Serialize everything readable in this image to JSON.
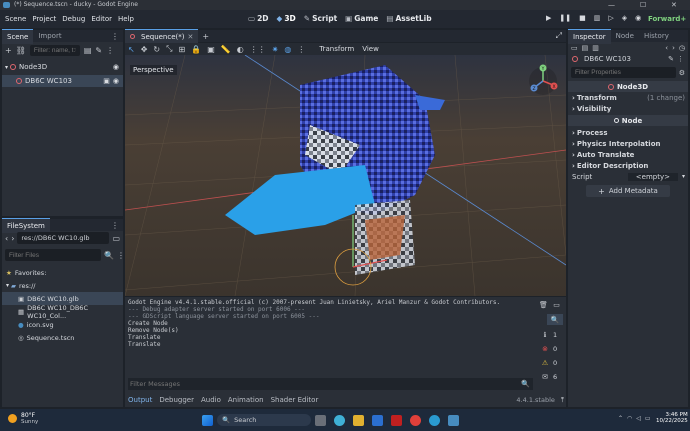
{
  "window": {
    "title": "(*) Sequence.tscn - ducky - Godot Engine",
    "minimize": "—",
    "maximize": "☐",
    "close": "✕"
  },
  "menu": [
    "Scene",
    "Project",
    "Debug",
    "Editor",
    "Help"
  ],
  "workspaces": [
    {
      "label": "2D",
      "icon": "▭"
    },
    {
      "label": "3D",
      "icon": "◆"
    },
    {
      "label": "Script",
      "icon": "✎"
    },
    {
      "label": "Game",
      "icon": "▣"
    },
    {
      "label": "AssetLib",
      "icon": "▤"
    }
  ],
  "renderer": "Forward+",
  "scene_dock": {
    "tabs": [
      "Scene",
      "Import"
    ],
    "filter_placeholder": "Filter: name, t:ty",
    "nodes": [
      {
        "name": "Node3D",
        "depth": 0
      },
      {
        "name": "DB6C WC103",
        "depth": 1
      }
    ]
  },
  "filesystem": {
    "tab": "FileSystem",
    "path": "res://DB6C WC10.glb",
    "filter_placeholder": "Filter Files",
    "favorites": "Favorites:",
    "root": "res://",
    "files": [
      {
        "name": "DB6C WC10.glb",
        "icon": "▣"
      },
      {
        "name": "DB6C WC10_DB6C WC10_Col...",
        "icon": "▦"
      },
      {
        "name": "icon.svg",
        "icon": "●"
      },
      {
        "name": "Sequence.tscn",
        "icon": "◎"
      }
    ]
  },
  "editor": {
    "tab": "Sequence(*)",
    "toolbar_menus": [
      "Transform",
      "View"
    ],
    "viewport_label": "Perspective",
    "gizmo_axes": [
      "Y",
      "X",
      "Z"
    ]
  },
  "output": {
    "lines": [
      "Godot Engine v4.4.1.stable.official (c) 2007-present Juan Linietsky, Ariel Manzur & Godot Contributors.",
      "--- Debug adapter server started on port 6006 ---",
      "--- GDScript language server started on port 6005 ---",
      "Create Node",
      "Remove Node(s)",
      "Translate",
      "Translate"
    ],
    "filter_placeholder": "Filter Messages",
    "counts": {
      "info": "1",
      "errors": "0",
      "warnings": "0",
      "messages": "6"
    },
    "bottom_tabs": [
      "Output",
      "Debugger",
      "Audio",
      "Animation",
      "Shader Editor"
    ],
    "version": "4.4.1.stable"
  },
  "inspector": {
    "tabs": [
      "Inspector",
      "Node",
      "History"
    ],
    "node_name": "DB6C WC103",
    "filter_placeholder": "Filter Properties",
    "class_header": "Node3D",
    "transform": "Transform",
    "transform_note": "(1 change)",
    "visibility": "Visibility",
    "node_header": "Node",
    "sections": [
      "Process",
      "Physics Interpolation",
      "Auto Translate",
      "Editor Description"
    ],
    "script_label": "Script",
    "script_value": "<empty>",
    "add_metadata": "Add Metadata"
  },
  "taskbar": {
    "weather_temp": "80°F",
    "weather_desc": "Sunny",
    "search": "Search",
    "time": "3:46 PM",
    "date": "10/22/2025"
  }
}
